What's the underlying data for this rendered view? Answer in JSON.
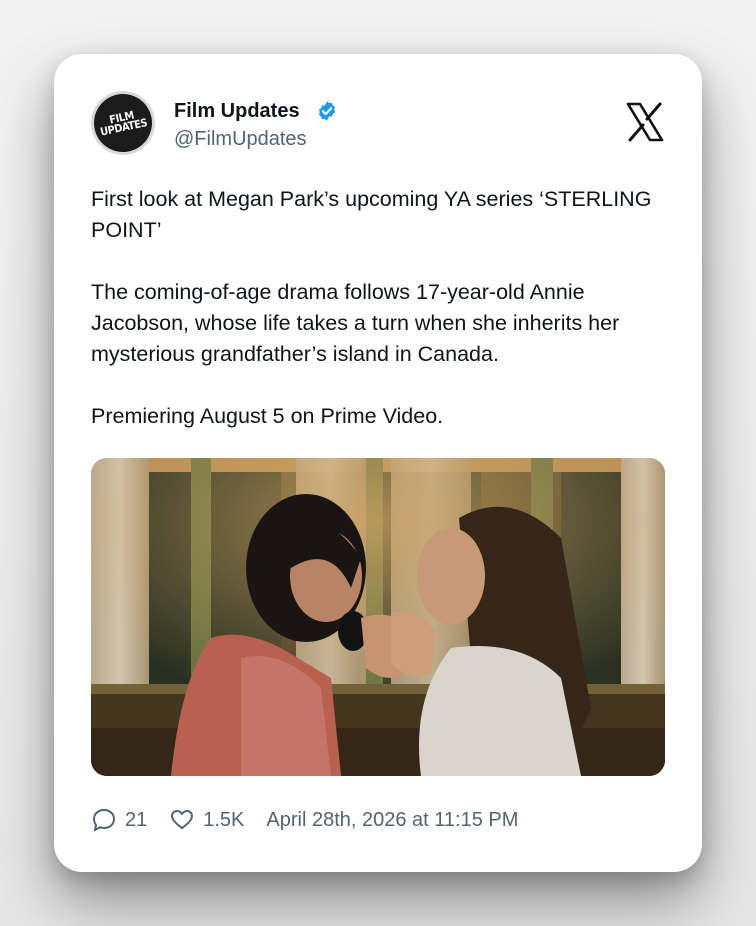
{
  "author": {
    "name": "Film Updates",
    "handle": "@FilmUpdates",
    "avatar_text_line1": "FILM",
    "avatar_text_line2": "UPDATES",
    "verified_icon": "verified-badge-icon"
  },
  "platform_icon": "x-logo-icon",
  "tweet": {
    "paragraph1": "First look at Megan Park’s upcoming YA series ‘STERLING POINT’",
    "paragraph2": "The coming-of-age drama follows 17-year-old Annie Jacobson, whose life takes a turn when she inherits her mysterious grandfather’s island in Canada.",
    "paragraph3": "Premiering August 5 on Prime Video."
  },
  "stats": {
    "replies": "21",
    "likes": "1.5K",
    "timestamp": "April 28th, 2026 at 11:15 PM"
  },
  "colors": {
    "verified": "#1d9bf0",
    "text": "#0f1419",
    "secondary": "#536471"
  }
}
